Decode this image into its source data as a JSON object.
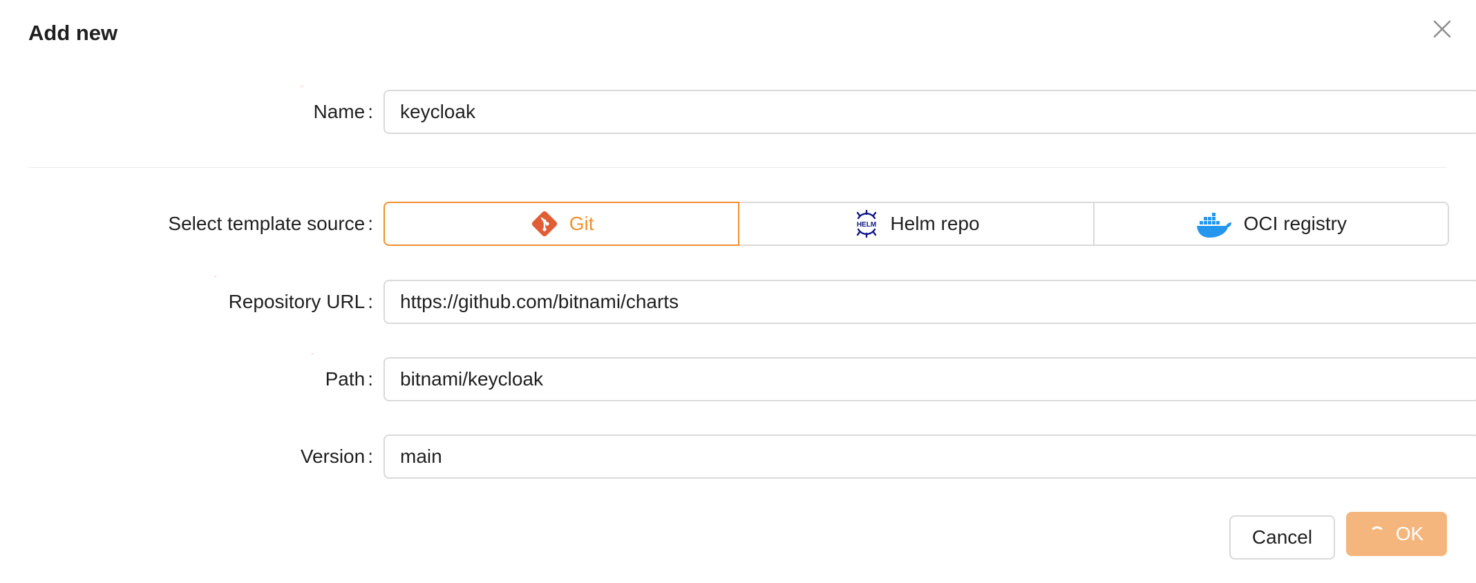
{
  "dialog": {
    "title": "Add new"
  },
  "form": {
    "name": {
      "label": "Name",
      "value": "keycloak",
      "required": true
    },
    "template_source": {
      "label": "Select template source",
      "options": [
        {
          "label": "Git",
          "icon": "git-icon",
          "selected": true
        },
        {
          "label": "Helm repo",
          "icon": "helm-icon",
          "selected": false
        },
        {
          "label": "OCI registry",
          "icon": "docker-icon",
          "selected": false
        }
      ]
    },
    "repository_url": {
      "label": "Repository URL",
      "value": "https://github.com/bitnami/charts",
      "required": true
    },
    "path": {
      "label": "Path",
      "value": "bitnami/keycloak",
      "required": true
    },
    "version": {
      "label": "Version",
      "value": "main"
    }
  },
  "footer": {
    "cancel_label": "Cancel",
    "ok_label": "OK",
    "ok_loading": true
  },
  "colors": {
    "accent": "#f0902d",
    "ok_button": "#f5b67d",
    "git_icon": "#e05d36",
    "helm_icon": "#0f1689",
    "docker_icon": "#2496ed",
    "required_marker": "#ff4d4f"
  },
  "label_separator": ":"
}
